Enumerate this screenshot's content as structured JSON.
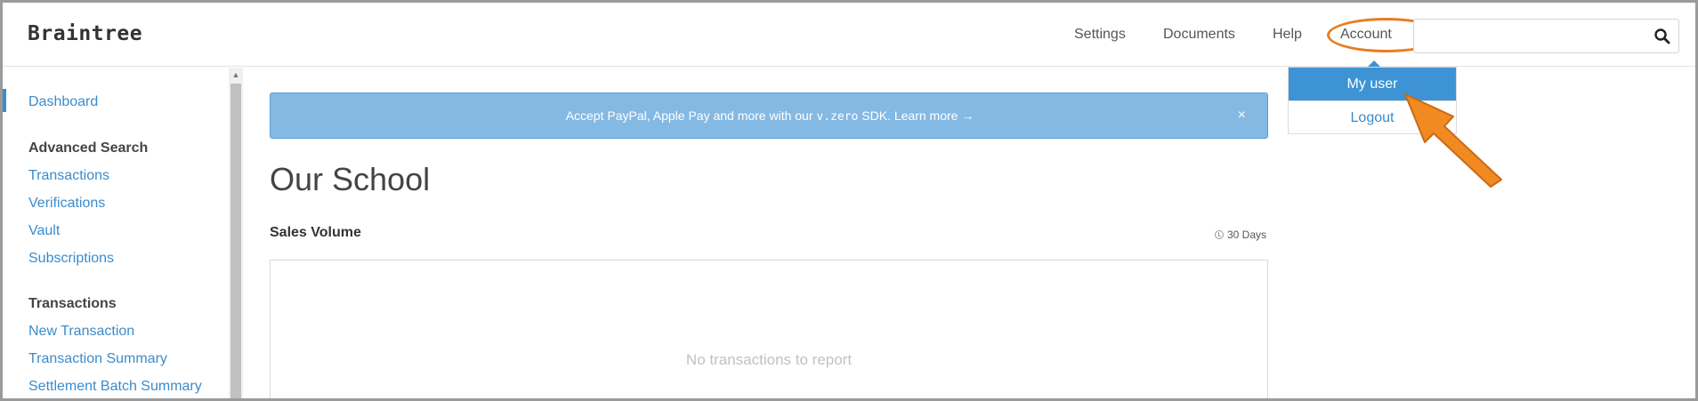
{
  "header": {
    "logo": "Braintree",
    "nav": {
      "settings": "Settings",
      "documents": "Documents",
      "help": "Help",
      "account": "Account"
    },
    "search": {
      "value": "",
      "placeholder": ""
    }
  },
  "account_menu": {
    "items": [
      "My user",
      "Logout"
    ]
  },
  "sidebar": {
    "dashboard": "Dashboard",
    "advanced_search": {
      "heading": "Advanced Search",
      "items": [
        "Transactions",
        "Verifications",
        "Vault",
        "Subscriptions"
      ]
    },
    "transactions": {
      "heading": "Transactions",
      "items": [
        "New Transaction",
        "Transaction Summary",
        "Settlement Batch Summary"
      ]
    }
  },
  "banner": {
    "text_before": "Accept PayPal, Apple Pay and more with our ",
    "code": "v.zero",
    "text_after": " SDK. Learn more →",
    "close": "×"
  },
  "main": {
    "title": "Our School",
    "section_title": "Sales Volume",
    "range": "30 Days",
    "empty_message": "No transactions to report"
  },
  "colors": {
    "link": "#3a8ccc",
    "banner_bg": "#84b9e3",
    "menu_active": "#3d93d3",
    "annotation": "#e87c1e"
  }
}
